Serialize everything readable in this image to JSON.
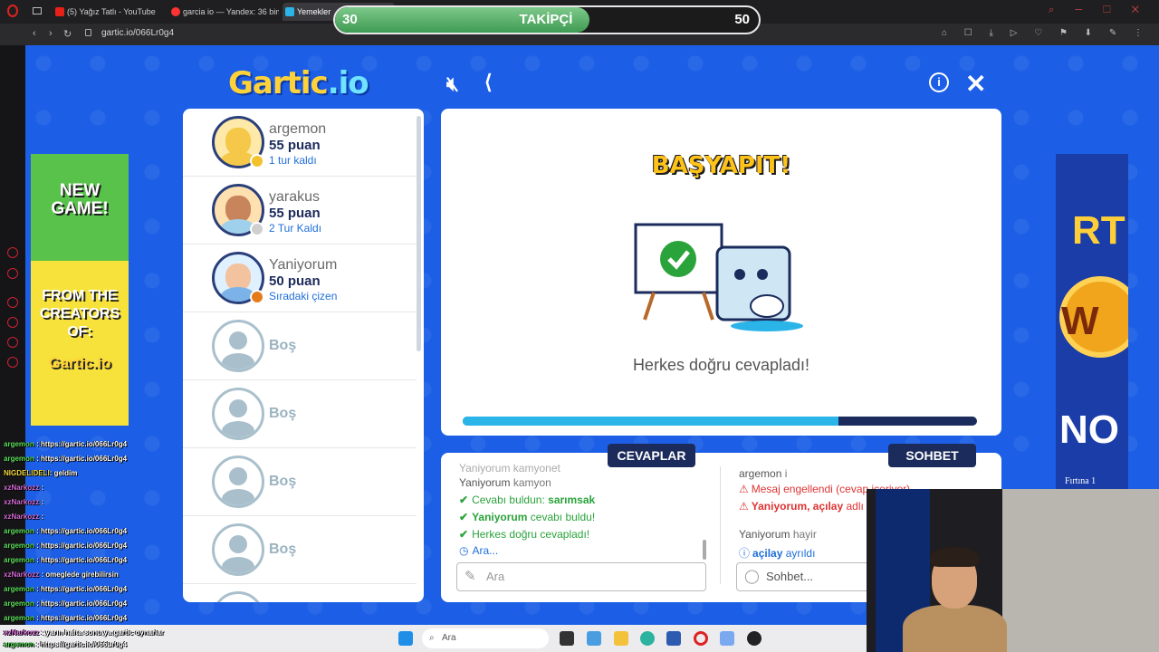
{
  "browser": {
    "tabs": [
      {
        "label": "(5) Yağız Tatlı - YouTube",
        "color": "#e62117"
      },
      {
        "label": "garcia io — Yandex: 36 bin",
        "color": "#f33"
      },
      {
        "label": "Yemekler",
        "color": "#2ab4e8"
      }
    ],
    "url": "gartic.io/066Lr0g4"
  },
  "followers": {
    "current": "30",
    "label": "TAKİPÇİ",
    "goal": "50",
    "progress": 0.6
  },
  "game": {
    "logo_main": "Gartic",
    "logo_suffix": ".io",
    "players": [
      {
        "name": "argemon",
        "points": "55 puan",
        "status": "1 tur kaldı",
        "face": "#f5c84a",
        "body": "#f5c84a",
        "badge": "#f2c12e"
      },
      {
        "name": "yarakus",
        "points": "55 puan",
        "status": "2 Tur Kaldı",
        "face": "#c8845a",
        "body": "#9fd0ec",
        "badge": "#cfcfcf"
      },
      {
        "name": "Yaniyorum",
        "points": "50 puan",
        "status": "Sıradaki çizen",
        "face": "#f3c3a0",
        "body": "#7bb3e8",
        "badge": "#e57c1c"
      }
    ],
    "empty_slots": [
      "Boş",
      "Boş",
      "Boş",
      "Boş"
    ],
    "masterpiece": "BAŞYAPIT!",
    "everyone_correct": "Herkes doğru cevapladı!",
    "round_progress": 0.73,
    "answers_tab": "CEVAPLAR",
    "chat_tab": "SOHBET",
    "answers": {
      "cut_line": "Yaniyorum kamyonet",
      "line1_user": "Yaniyorum",
      "line1_text": "kamyon",
      "found_prefix": "Cevabı buldun:",
      "found_word": "sarımsak",
      "found_user": "Yaniyorum",
      "found_user_text": "cevabı buldu!",
      "everyone": "Herkes doğru cevapladı!",
      "searching": "Ara..."
    },
    "answer_input_placeholder": "Ara",
    "chat": {
      "line1_user": "argemon",
      "line1_text": "i",
      "blocked": "Mesaj engellendi (cevap içeriyor)",
      "vote_user": "Yaniyorum",
      "vote_mid": ", açılay",
      "vote_tail": " adlı oy verdi",
      "line4_user": "Yaniyorum",
      "line4_text": "hayir",
      "left_user": "açilay",
      "left_text": "ayrıldı"
    },
    "chat_input_placeholder": "Sohbet..."
  },
  "ads": {
    "left_lines": [
      "NEW",
      "GAME!",
      "FROM THE",
      "CREATORS",
      "OF:",
      "Gartic.io"
    ],
    "right_caption": "Fırtına 1"
  },
  "stream_chat": [
    {
      "user": "argemon",
      "text": ": https://gartic.io/066Lr0g4",
      "cls": "u"
    },
    {
      "user": "argemon",
      "text": ": https://gartic.io/066Lr0g4",
      "cls": "u"
    },
    {
      "user": "NIGDELIDELI",
      "text": ": geldim",
      "cls": "y"
    },
    {
      "user": "xzNarkozz",
      "text": ":",
      "cls": "p"
    },
    {
      "user": "xzNarkozz",
      "text": ":",
      "cls": "p"
    },
    {
      "user": "xzNarkozz",
      "text": ":",
      "cls": "p"
    },
    {
      "user": "argemon",
      "text": ": https://gartic.io/066Lr0g4",
      "cls": "u"
    },
    {
      "user": "argemon",
      "text": ": https://gartic.io/066Lr0g4",
      "cls": "u"
    },
    {
      "user": "argemon",
      "text": ": https://gartic.io/066Lr0g4",
      "cls": "u"
    },
    {
      "user": "xzNarkozz",
      "text": ": omeglede girebilirsin",
      "cls": "p"
    },
    {
      "user": "argemon",
      "text": ": https://gartic.io/066Lr0g4",
      "cls": "u"
    },
    {
      "user": "argemon",
      "text": ": https://gartic.io/066Lr0g4",
      "cls": "u"
    },
    {
      "user": "argemon",
      "text": ": https://gartic.io/066Lr0g4",
      "cls": "u"
    },
    {
      "user": "xzNarkozz",
      "text": ": yarın hafta sonu ya gartic oynarlar",
      "cls": "p"
    },
    {
      "user": "argemon",
      "text": ": https://gartic.io/066Lr0g4",
      "cls": "u"
    }
  ],
  "taskbar": {
    "search_placeholder": "Ara"
  }
}
